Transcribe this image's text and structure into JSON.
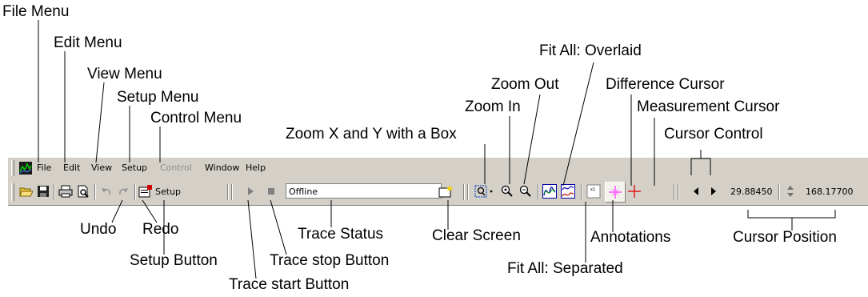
{
  "callouts": {
    "file_menu": "File Menu",
    "edit_menu": "Edit Menu",
    "view_menu": "View Menu",
    "setup_menu": "Setup Menu",
    "control_menu": "Control Menu",
    "zoom_box": "Zoom X and Y with a Box",
    "zoom_in": "Zoom In",
    "zoom_out": "Zoom Out",
    "fit_all_overlaid": "Fit All: Overlaid",
    "difference_cursor": "Difference Cursor",
    "measurement_cursor": "Measurement Cursor",
    "cursor_control": "Cursor Control",
    "undo": "Undo",
    "redo": "Redo",
    "trace_status": "Trace Status",
    "clear_screen": "Clear Screen",
    "annotations": "Annotations",
    "cursor_position": "Cursor Position",
    "setup_button": "Setup Button",
    "trace_stop_button": "Trace stop Button",
    "fit_all_separated": "Fit All: Separated",
    "trace_start_button": "Trace start Button"
  },
  "menubar": {
    "items": [
      "File",
      "Edit",
      "View",
      "Setup",
      "Control",
      "Window",
      "Help"
    ],
    "disabled": [
      "Control"
    ]
  },
  "toolbar": {
    "setup_label": "Setup",
    "trace_status": "Offline",
    "cursor_x": "29.88450",
    "cursor_y": "168.17700"
  },
  "icons": [
    "app-icon",
    "open-icon",
    "save-icon",
    "print-icon",
    "print-preview-icon",
    "undo-icon",
    "redo-icon",
    "setup-icon",
    "play-icon",
    "stop-icon",
    "clear-screen-icon",
    "zoom-box-icon",
    "zoom-in-icon",
    "zoom-out-icon",
    "fit-overlaid-icon",
    "fit-separated-icon",
    "annotations-icon",
    "difference-cursor-icon",
    "measurement-cursor-icon",
    "cursor-left-icon",
    "cursor-right-icon",
    "up-down-icon"
  ]
}
